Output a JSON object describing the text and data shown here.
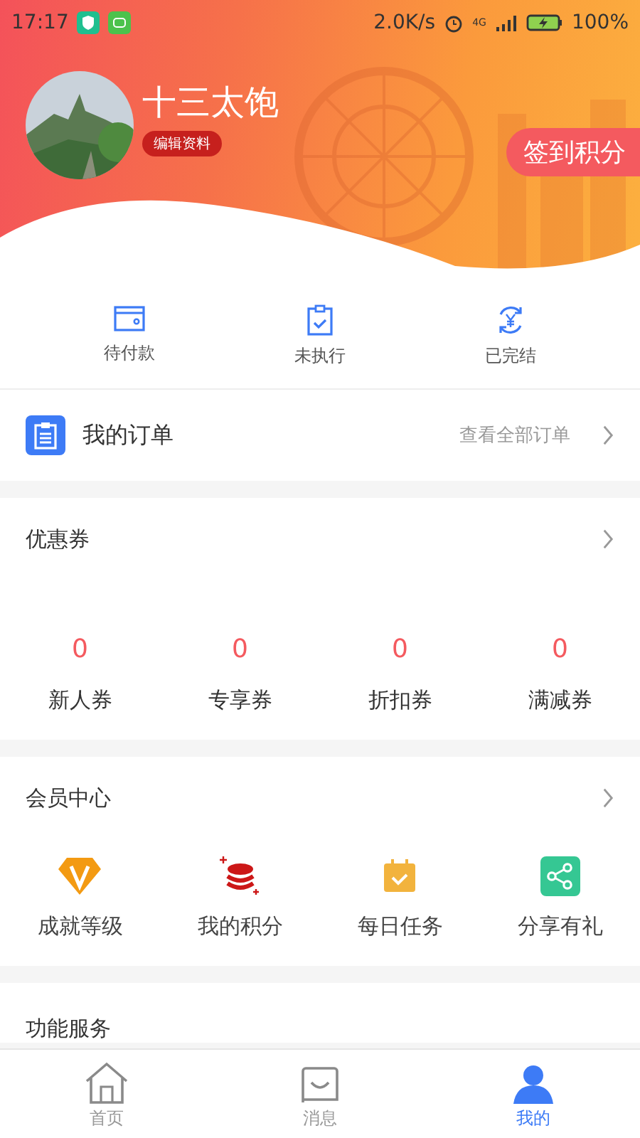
{
  "status_bar": {
    "time": "17:17",
    "speed": "2.0K/s",
    "network": "4G",
    "battery": "100%"
  },
  "profile": {
    "name": "十三太饱",
    "edit_label": "编辑资料",
    "checkin_button": "签到积分"
  },
  "order_status": [
    {
      "kind": "wallet",
      "label": "待付款"
    },
    {
      "kind": "clipboard",
      "label": "未执行"
    },
    {
      "kind": "refresh",
      "label": "已完结"
    }
  ],
  "my_orders": {
    "title": "我的订单",
    "link": "查看全部订单"
  },
  "coupons": {
    "title": "优惠券",
    "items": [
      {
        "count": "0",
        "label": "新人券"
      },
      {
        "count": "0",
        "label": "专享券"
      },
      {
        "count": "0",
        "label": "折扣券"
      },
      {
        "count": "0",
        "label": "满减券"
      }
    ]
  },
  "member_center": {
    "title": "会员中心",
    "items": [
      {
        "kind": "diamond",
        "label": "成就等级"
      },
      {
        "kind": "coins",
        "label": "我的积分"
      },
      {
        "kind": "calendar",
        "label": "每日任务"
      },
      {
        "kind": "share",
        "label": "分享有礼"
      }
    ]
  },
  "services": {
    "title": "功能服务"
  },
  "tab_bar": [
    {
      "kind": "home",
      "label": "首页",
      "selected": false
    },
    {
      "kind": "message",
      "label": "消息",
      "selected": false
    },
    {
      "kind": "user",
      "label": "我的",
      "selected": true
    }
  ]
}
